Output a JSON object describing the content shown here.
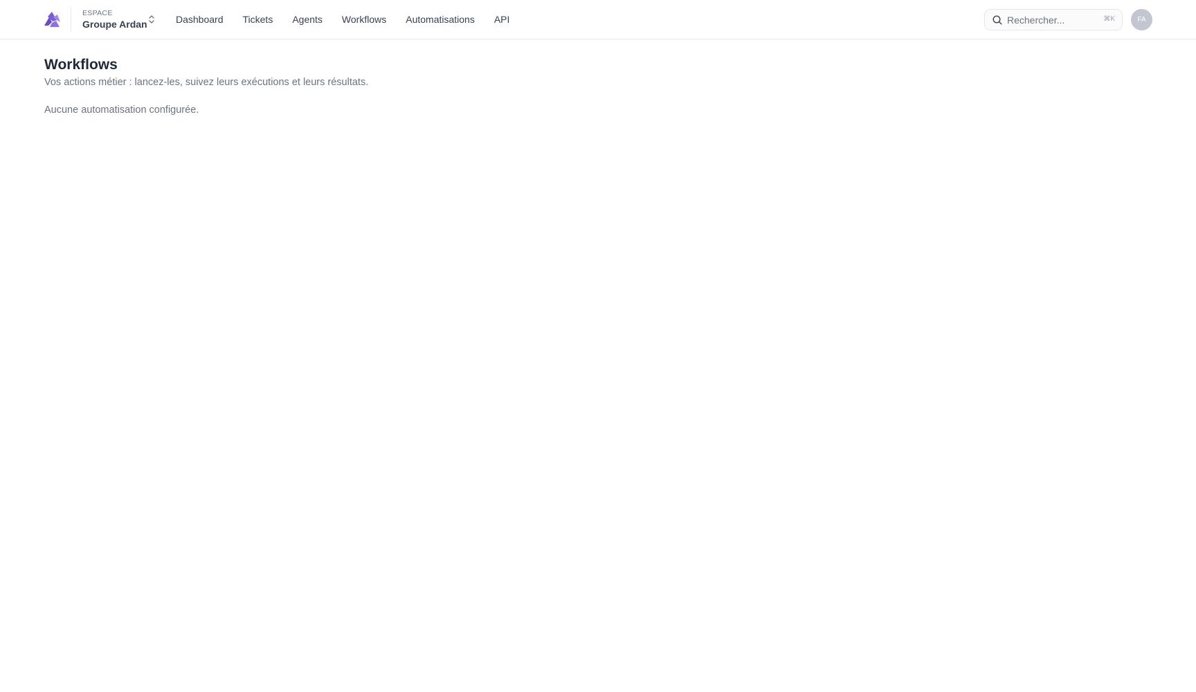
{
  "header": {
    "workspace": {
      "kicker": "ESPACE",
      "name": "Groupe Ardan"
    },
    "nav": [
      {
        "label": "Dashboard"
      },
      {
        "label": "Tickets"
      },
      {
        "label": "Agents"
      },
      {
        "label": "Workflows"
      },
      {
        "label": "Automatisations"
      },
      {
        "label": "API"
      }
    ],
    "search": {
      "placeholder": "Rechercher...",
      "shortcut": "⌘K"
    },
    "avatar": {
      "initials": "FA"
    }
  },
  "main": {
    "title": "Workflows",
    "subtitle": "Vos actions métier : lancez-les, suivez leurs exécutions et leurs résultats.",
    "empty_message": "Aucune automatisation configurée."
  },
  "icons": {
    "logo": "brand-logo-icon",
    "workspace_switcher": "chevron-up-down-icon",
    "search": "search-icon"
  },
  "colors": {
    "brand": "#7c5cd6",
    "brand_dark": "#6a4bc4",
    "border": "#e5e7eb",
    "text_primary": "#1f2937",
    "text_muted": "#6b7280",
    "avatar_bg": "#c2c6d1"
  }
}
